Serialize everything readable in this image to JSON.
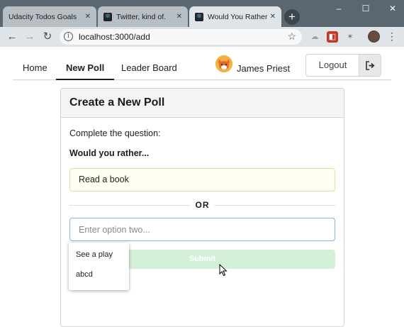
{
  "browser": {
    "tabs": [
      {
        "title": "Udacity Todos Goals",
        "icon": "page-icon",
        "active": false
      },
      {
        "title": "Twitter, kind of.",
        "icon": "react-icon",
        "active": false
      },
      {
        "title": "Would You Rather ?",
        "icon": "react-icon",
        "active": true
      }
    ],
    "new_tab_symbol": "+",
    "url": "localhost:3000/add",
    "window_controls": [
      "–",
      "☐",
      "✕"
    ],
    "close_symbol": "✕"
  },
  "nav": {
    "items": [
      {
        "label": "Home",
        "active": false
      },
      {
        "label": "New Poll",
        "active": true
      },
      {
        "label": "Leader Board",
        "active": false
      }
    ],
    "user_name": "James Priest",
    "logout_label": "Logout",
    "logout_icon": "sign-out-icon"
  },
  "card": {
    "title": "Create a New Poll",
    "instruction": "Complete the question:",
    "question": "Would you rather...",
    "option_one_value": "Read a book",
    "divider_text": "OR",
    "option_two_placeholder": "Enter option two...",
    "submit_label": "Submit"
  },
  "autocomplete": {
    "suggestions": [
      "See a play",
      "abcd"
    ]
  },
  "colors": {
    "chrome_tabbar": "#5b6770",
    "chrome_toolbar": "#dfe4e8",
    "option_one_bg": "#fffff2",
    "submit_bg_disabled": "#d3f0d8",
    "input_focus_border": "#85b7d9"
  }
}
